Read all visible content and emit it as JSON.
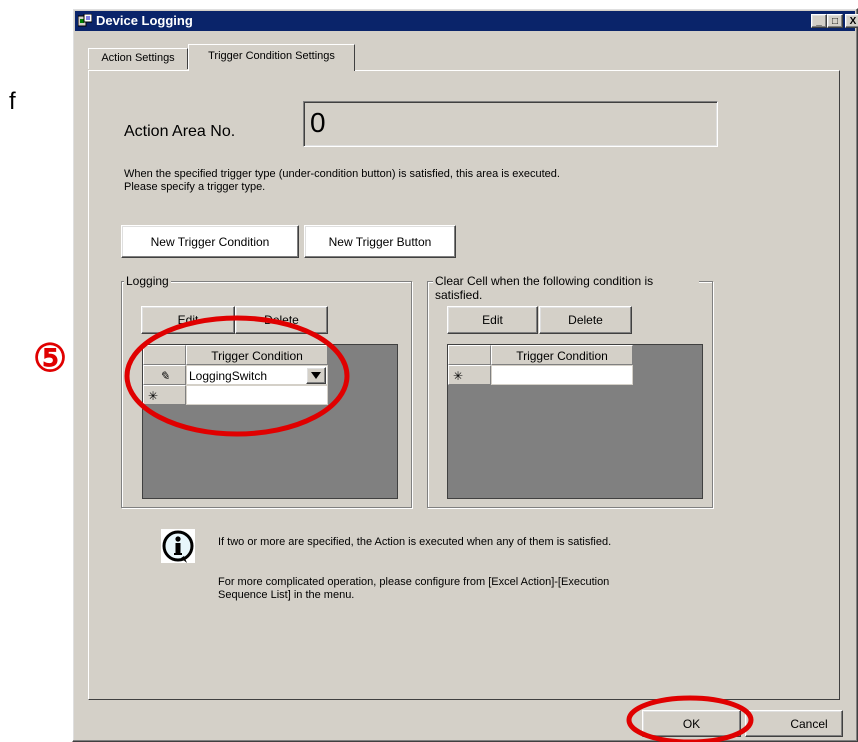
{
  "page": {
    "stray_char": "f"
  },
  "annotation": {
    "step_marker": "⑤"
  },
  "window": {
    "title": "Device Logging",
    "controls": {
      "minimize": "_",
      "maximize": "□",
      "close": "X"
    }
  },
  "tabs": [
    {
      "label": "Action Settings",
      "active": false
    },
    {
      "label": "Trigger Condition Settings",
      "active": true
    }
  ],
  "action_area": {
    "label": "Action Area No.",
    "value": "0"
  },
  "description": {
    "line1": "When the specified trigger type (under-condition button) is satisfied, this area is executed.",
    "line2": "Please specify a trigger type."
  },
  "buttons": {
    "new_trigger_condition": "New Trigger Condition",
    "new_trigger_button": "New Trigger Button",
    "ok": "OK",
    "cancel": "Cancel"
  },
  "logging": {
    "legend": "Logging",
    "edit": "Edit",
    "delete": "Delete",
    "column_header": "Trigger Condition",
    "rows": [
      {
        "marker": "✎",
        "value": "LoggingSwitch"
      }
    ],
    "new_row_marker": "✳"
  },
  "clear_cell": {
    "legend_line1": "Clear Cell when the following condition is",
    "legend_line2": "satisfied.",
    "edit": "Edit",
    "delete": "Delete",
    "column_header": "Trigger Condition",
    "new_row_marker": "✳"
  },
  "info": {
    "icon": "i",
    "line1": "If two or more are specified, the Action is executed when any of them is satisfied.",
    "line2": "For more complicated operation, please configure from [Excel Action]-[Execution",
    "line3": "Sequence List] in the menu."
  },
  "colors": {
    "titlebar": "#0a246a",
    "face": "#d4d0c8",
    "grid_bg": "#808080",
    "annotation": "#e00000"
  }
}
